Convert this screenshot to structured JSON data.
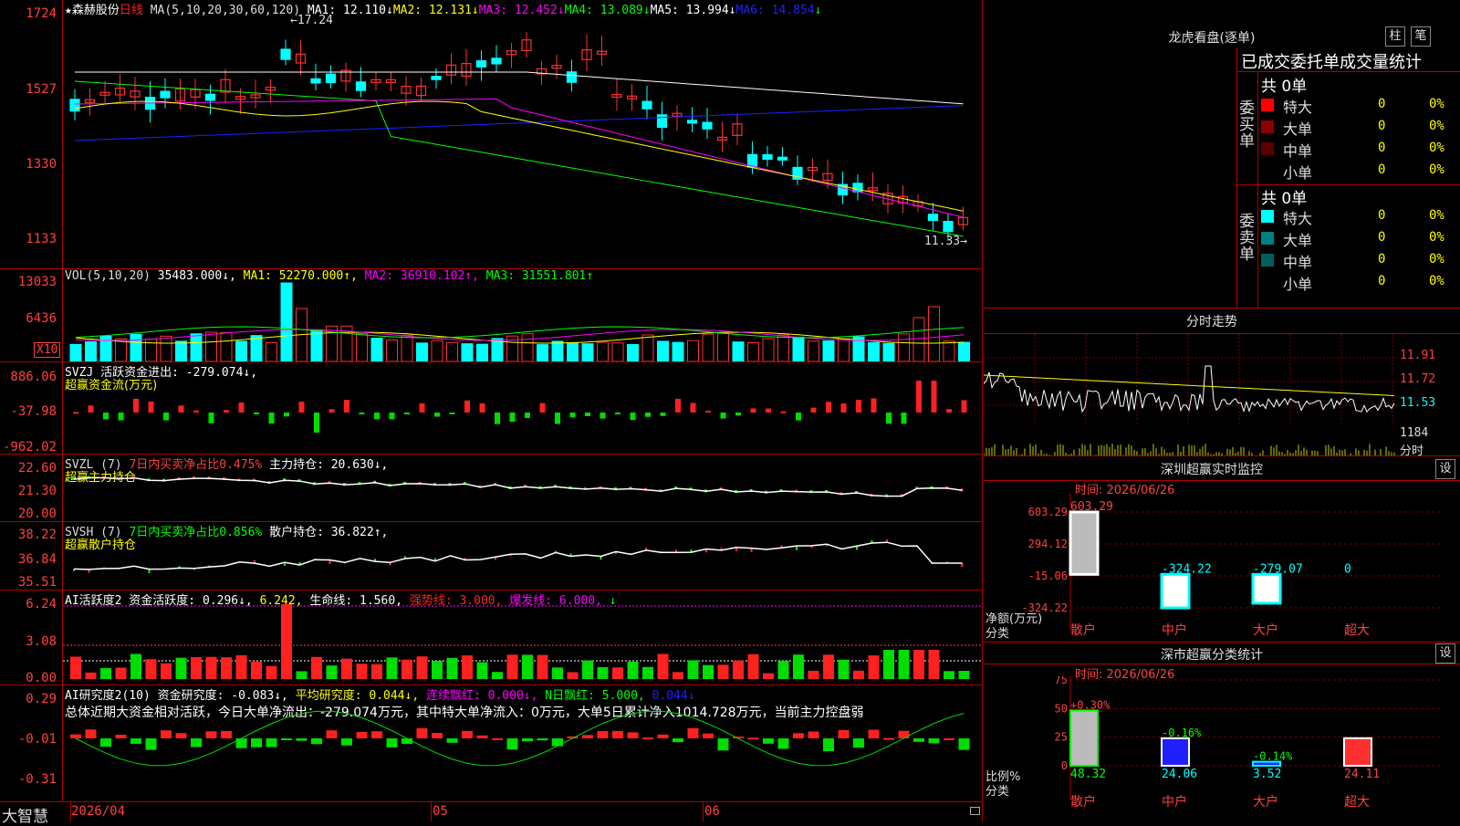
{
  "main_chart": {
    "star_icon_char": "★",
    "stock_name": "森赫股份",
    "period": "日线",
    "ma_label": "MA(5,10,20,30,60,120)",
    "ma_values": [
      {
        "text": "MA1: 12.110↓",
        "color": "#ffffff"
      },
      {
        "text": "MA2: 12.131↓",
        "color": "#ffff00"
      },
      {
        "text": "MA3: 12.452↓",
        "color": "#ff00ff"
      },
      {
        "text": "MA4: 13.089↓",
        "color": "#00ff00"
      },
      {
        "text": "MA5: 13.994↓",
        "color": "#ffffff"
      },
      {
        "text": "MA6: 14.854",
        "color": "#2020ff"
      },
      {
        "text": "↓",
        "color": "#00ff00"
      }
    ],
    "y_ticks": [
      "1724",
      "1527",
      "1330",
      "1133"
    ],
    "high_note": "17.24",
    "low_note": "11.33"
  },
  "vol_chart": {
    "header": [
      {
        "text": "VOL(5,10,20)",
        "color": "#dddddd"
      },
      {
        "text": " 35483.000↓,",
        "color": "#ffffff"
      },
      {
        "text": " MA1: 52270.000↑,",
        "color": "#ffff00"
      },
      {
        "text": " MA2: 36910.102↑,",
        "color": "#ff00ff"
      },
      {
        "text": " MA3: 31551.801↑",
        "color": "#00ff00"
      }
    ],
    "y_ticks": [
      "13033",
      "6436"
    ],
    "unit": "X10"
  },
  "svzj": {
    "header": [
      {
        "text": "SVZJ  活跃资金进出: -279.074↓,",
        "color": "#ffffff"
      }
    ],
    "sub": "超赢资金流(万元)",
    "y_ticks": [
      "886.06",
      "-37.98",
      "-962.02"
    ]
  },
  "svzl": {
    "header": [
      {
        "text": "SVZL (7) ",
        "color": "#dddddd"
      },
      {
        "text": "7日内买卖净占比0.475%",
        "color": "#ff4040"
      },
      {
        "text": " 主力持仓: 20.630↓,",
        "color": "#ffffff"
      }
    ],
    "sub": "超赢主力持仓",
    "y_ticks": [
      "22.60",
      "21.30",
      "20.00"
    ]
  },
  "svsh": {
    "header": [
      {
        "text": "SVSH (7) ",
        "color": "#dddddd"
      },
      {
        "text": "7日内买卖净占比0.856%",
        "color": "#00ff00"
      },
      {
        "text": " 散户持仓: 36.822↑,",
        "color": "#ffffff"
      }
    ],
    "sub": "超赢散户持仓",
    "y_ticks": [
      "38.22",
      "36.84",
      "35.51"
    ]
  },
  "ai_active": {
    "header": [
      {
        "text": "AI活跃度2 资金活跃度: 0.296↓,",
        "color": "#ffffff"
      },
      {
        "text": " 6.242,",
        "color": "#ffff00"
      },
      {
        "text": " 生命线: 1.560,",
        "color": "#ffffff"
      },
      {
        "text": " 强势线: 3.000,",
        "color": "#ff2020"
      },
      {
        "text": " 爆发线: 6.000,",
        "color": "#ff00ff"
      },
      {
        "text": "   ↓",
        "color": "#00ff00"
      }
    ],
    "y_ticks": [
      "6.24",
      "3.08",
      "0.00"
    ]
  },
  "ai_research": {
    "header": [
      {
        "text": "AI研究度2(10) 资金研究度: -0.083↓,",
        "color": "#ffffff"
      },
      {
        "text": " 平均研究度: 0.044↓,",
        "color": "#ffff00"
      },
      {
        "text": " 连续飘红: 0.000↓,",
        "color": "#ff00ff"
      },
      {
        "text": " N日飘红: 5.000,",
        "color": "#00ff00"
      },
      {
        "text": " 0.044↓",
        "color": "#2020ff"
      }
    ],
    "summary": "总体近期大资金相对活跃，今日大单净流出：-279.074万元，其中特大单净流入：0万元，大单5日累计净入1014.728万元，当前主力控盘弱",
    "y_ticks": [
      "0.29",
      "-0.01",
      "-0.31"
    ]
  },
  "x_axis": {
    "brand": "大智慧",
    "labels": [
      "2026/04",
      "05",
      "06"
    ]
  },
  "dragon_tiger": {
    "title": "龙虎看盘(逐单)",
    "btn_a": "柱",
    "btn_b": "笔",
    "subtitle": "已成交委托单成交量统计",
    "buy_label": "委买单",
    "sell_label": "委卖单",
    "buy_total": "共 0单",
    "sell_total": "共 0单",
    "buy_rows": [
      {
        "name": "特大",
        "count": "0",
        "pct": "0%",
        "color": "#ff0000"
      },
      {
        "name": "大单",
        "count": "0",
        "pct": "0%",
        "color": "#8b0000"
      },
      {
        "name": "中单",
        "count": "0",
        "pct": "0%",
        "color": "#5a0000"
      },
      {
        "name": "小单",
        "count": "0",
        "pct": "0%",
        "color": ""
      }
    ],
    "sell_rows": [
      {
        "name": "特大",
        "count": "0",
        "pct": "0%",
        "color": "#00ffff"
      },
      {
        "name": "大单",
        "count": "0",
        "pct": "0%",
        "color": "#008080"
      },
      {
        "name": "中单",
        "count": "0",
        "pct": "0%",
        "color": "#006060"
      },
      {
        "name": "小单",
        "count": "0",
        "pct": "0%",
        "color": ""
      }
    ]
  },
  "intraday": {
    "title": "分时走势",
    "y_ticks": [
      "11.91",
      "11.72",
      "11.53"
    ],
    "vol_tick": "1184",
    "unit": "分时"
  },
  "sz_monitor": {
    "title": "深圳超赢实时监控",
    "setting": "设",
    "time": "时间: 2026/06/26",
    "y_ticks": [
      "603.29",
      "294.12",
      "-15.06",
      "-324.22"
    ],
    "ylabel": "净额(万元)",
    "xlabel": "分类",
    "bars": [
      {
        "cat": "散户",
        "value": 603.29,
        "label": "603.29"
      },
      {
        "cat": "中户",
        "value": -324.22,
        "label": "-324.22"
      },
      {
        "cat": "大户",
        "value": -279.07,
        "label": "-279.07"
      },
      {
        "cat": "超大",
        "value": 0,
        "label": "0"
      }
    ]
  },
  "sz_stats": {
    "title": "深市超赢分类统计",
    "setting": "设",
    "time": "时间: 2026/06/26",
    "y_ticks": [
      "75",
      "50",
      "25",
      "0"
    ],
    "ylabel": "比例%",
    "xlabel": "分类",
    "bars": [
      {
        "cat": "散户",
        "value": 48.32,
        "label": "48.32",
        "change": "+0.30%"
      },
      {
        "cat": "中户",
        "value": 24.06,
        "label": "24.06",
        "change": "-0.16%"
      },
      {
        "cat": "大户",
        "value": 3.52,
        "label": "3.52",
        "change": "-0.14%"
      },
      {
        "cat": "超大",
        "value": 24.11,
        "label": "24.11",
        "change": ""
      }
    ]
  }
}
